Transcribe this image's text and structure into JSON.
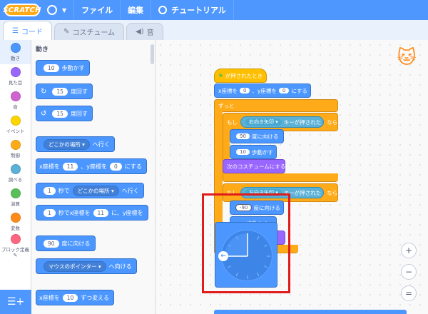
{
  "menubar": {
    "logo_text": "SCRATCH",
    "file_label": "ファイル",
    "edit_label": "編集",
    "tutorials_label": "チュートリアル"
  },
  "tabs": [
    {
      "label": "コード",
      "icon": "code-icon"
    },
    {
      "label": "コスチューム",
      "icon": "brush-icon"
    },
    {
      "label": "音",
      "icon": "speaker-icon"
    }
  ],
  "categories": [
    {
      "label": "動き",
      "color": "#4c97ff"
    },
    {
      "label": "見た目",
      "color": "#9966ff"
    },
    {
      "label": "音",
      "color": "#cf63cf"
    },
    {
      "label": "イベント",
      "color": "#ffd500"
    },
    {
      "label": "制御",
      "color": "#ffab19"
    },
    {
      "label": "調べる",
      "color": "#5cb1d6"
    },
    {
      "label": "演算",
      "color": "#59c059"
    },
    {
      "label": "変数",
      "color": "#ff8c1a"
    },
    {
      "label": "ブロック定義",
      "color": "#ff6680"
    }
  ],
  "palette": {
    "title": "動き",
    "move": {
      "value": "10",
      "text": "歩動かす"
    },
    "turn_right": {
      "value": "15",
      "text": "度回す"
    },
    "turn_left": {
      "value": "15",
      "text": "度回す"
    },
    "goto": {
      "dropdown": "どこかの場所",
      "text": "へ行く"
    },
    "goto_xy": {
      "a": "x座標を",
      "x": "11",
      "b": "、y座標を",
      "y": "0",
      "c": "にする"
    },
    "glide": {
      "value": "1",
      "a": "秒で",
      "dropdown": "どこかの場所",
      "b": "へ行く"
    },
    "glide_xy": {
      "value": "1",
      "a": "秒でx座標を",
      "x": "11",
      "b": "に、y座標を"
    },
    "point_dir": {
      "value": "90",
      "text": "度に向ける"
    },
    "point_towards": {
      "dropdown": "マウスのポインター",
      "text": "へ向ける"
    },
    "change_x": {
      "a": "x座標を",
      "value": "10",
      "b": "ずつ変える"
    }
  },
  "script": {
    "hat": "が押されたとき",
    "goto_xy": {
      "a": "x座標を",
      "x": "0",
      "b": "、y座標を",
      "y": "0",
      "c": "にする"
    },
    "forever": "ずっと",
    "if1": {
      "a": "もし",
      "key": "右向き矢印",
      "b": "キーが押された",
      "c": "なら"
    },
    "dir1": {
      "value": "90",
      "text": "度に向ける"
    },
    "move1": {
      "value": "10",
      "text": "歩動かす"
    },
    "next_costume": "次のコスチュームにする",
    "if2": {
      "a": "もし",
      "key": "左向き矢印",
      "b": "キーが押された",
      "c": "なら"
    },
    "dir2": {
      "value": "-90",
      "text": "度に向ける"
    },
    "partial_hidden": "歩動かす"
  },
  "zoom": {
    "in": "+",
    "out": "−",
    "reset": "="
  }
}
